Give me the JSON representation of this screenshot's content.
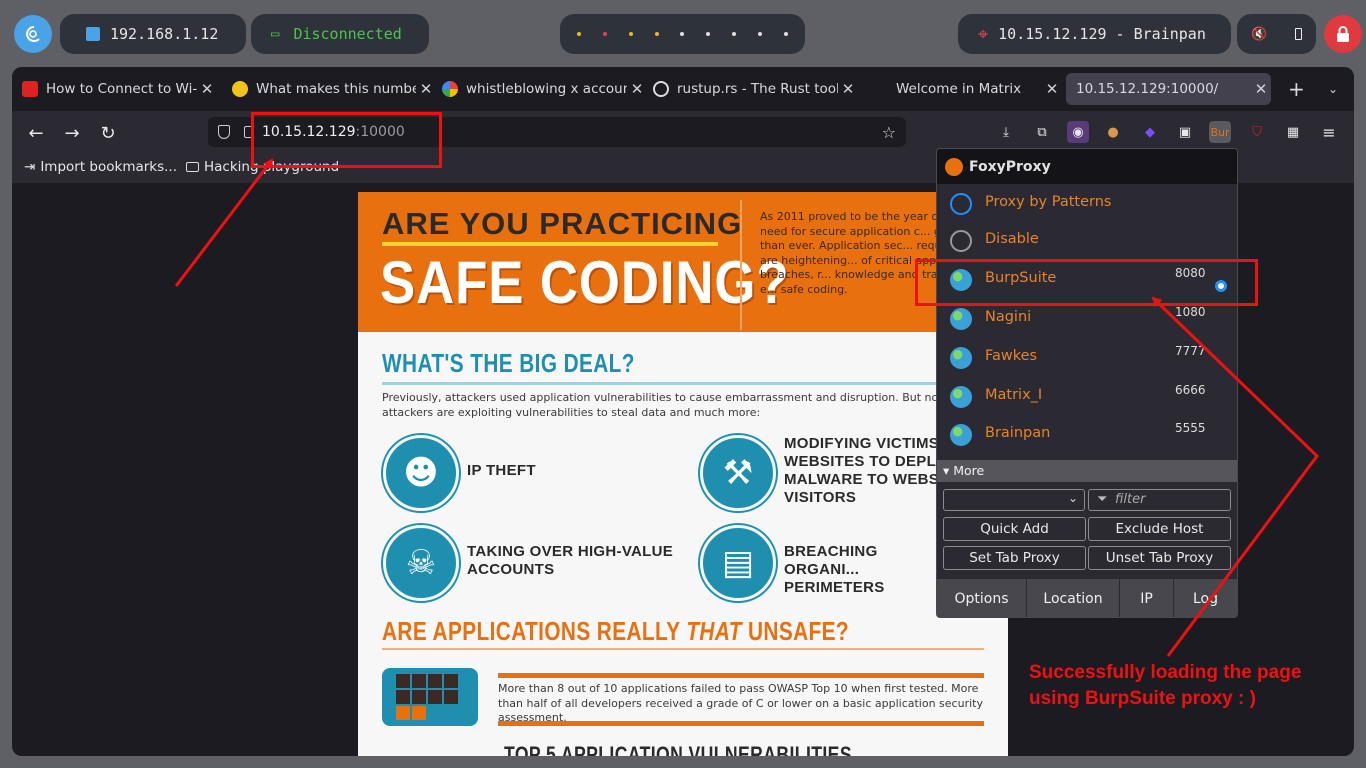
{
  "topbar": {
    "ip": "192.168.1.12",
    "vpn_status": "Disconnected",
    "target": "10.15.12.129 - Brainpan"
  },
  "tabs": [
    {
      "title": "How to Connect to Wi-Fi"
    },
    {
      "title": "What makes this number"
    },
    {
      "title": "whistleblowing x account"
    },
    {
      "title": "rustup.rs - The Rust tool"
    },
    {
      "title": "Welcome in Matrix"
    },
    {
      "title": "10.15.12.129:10000/"
    }
  ],
  "urlbar": {
    "host": "10.15.12.129",
    "port": ":10000"
  },
  "bookmarks": [
    {
      "label": "Import bookmarks..."
    },
    {
      "label": "Hacking playground"
    }
  ],
  "infographic": {
    "title_line1": "ARE YOU PRACTICING",
    "title_line2": "SAFE CODING?",
    "intro": "As 2011 proved to be the year of i... the need for secure application c... greater than ever. Application sec... requirements are heightening... of critical application breaches, r... knowledge and training must e... safe coding.",
    "section1": "WHAT'S THE BIG DEAL?",
    "section1_text": "Previously, attackers used application vulnerabilities to cause embarrassment and disruption. But now th... attackers are exploiting vulnerabilities to steal data and much more:",
    "items": [
      {
        "label": "IP THEFT"
      },
      {
        "label": "MODIFYING VICTIMS' WEBSITES TO DEPLOY MALWARE TO WEBSITE VISITORS"
      },
      {
        "label": "TAKING OVER HIGH-VALUE ACCOUNTS"
      },
      {
        "label": "BREACHING ORGANI... PERIMETERS"
      }
    ],
    "section2_a": "ARE APPLICATIONS REALLY ",
    "section2_b": "THAT",
    "section2_c": " UNSAFE?",
    "section2_text": "More than 8 out of 10 applications failed to pass OWASP Top 10 when first tested. More than half of all developers received a grade of C or lower on a basic application security assessment.",
    "section3": "TOP 5 APPLICATION VULNERABILITIES"
  },
  "foxyproxy": {
    "title": "FoxyProxy",
    "modes": [
      {
        "label": "Proxy by Patterns"
      },
      {
        "label": "Disable"
      }
    ],
    "proxies": [
      {
        "name": "BurpSuite",
        "port": "8080",
        "selected": true
      },
      {
        "name": "Nagini",
        "port": "1080"
      },
      {
        "name": "Fawkes",
        "port": "7777"
      },
      {
        "name": "Matrix_I",
        "port": "6666"
      },
      {
        "name": "Brainpan",
        "port": "5555"
      }
    ],
    "more_label": "More",
    "filter_placeholder": "filter",
    "buttons": {
      "quick_add": "Quick Add",
      "exclude_host": "Exclude Host",
      "set_tab_proxy": "Set Tab Proxy",
      "unset_tab_proxy": "Unset Tab Proxy"
    },
    "footer": [
      "Options",
      "Location",
      "IP",
      "Log"
    ]
  },
  "annotation": {
    "line1": "Successfully loading the page",
    "line2": "using BurpSuite proxy : )"
  },
  "colors": {
    "accent_orange": "#e8700f",
    "accent_blue": "#1f8fb0",
    "annotation_red": "#ee1111",
    "foxy_label": "#e7832a"
  }
}
